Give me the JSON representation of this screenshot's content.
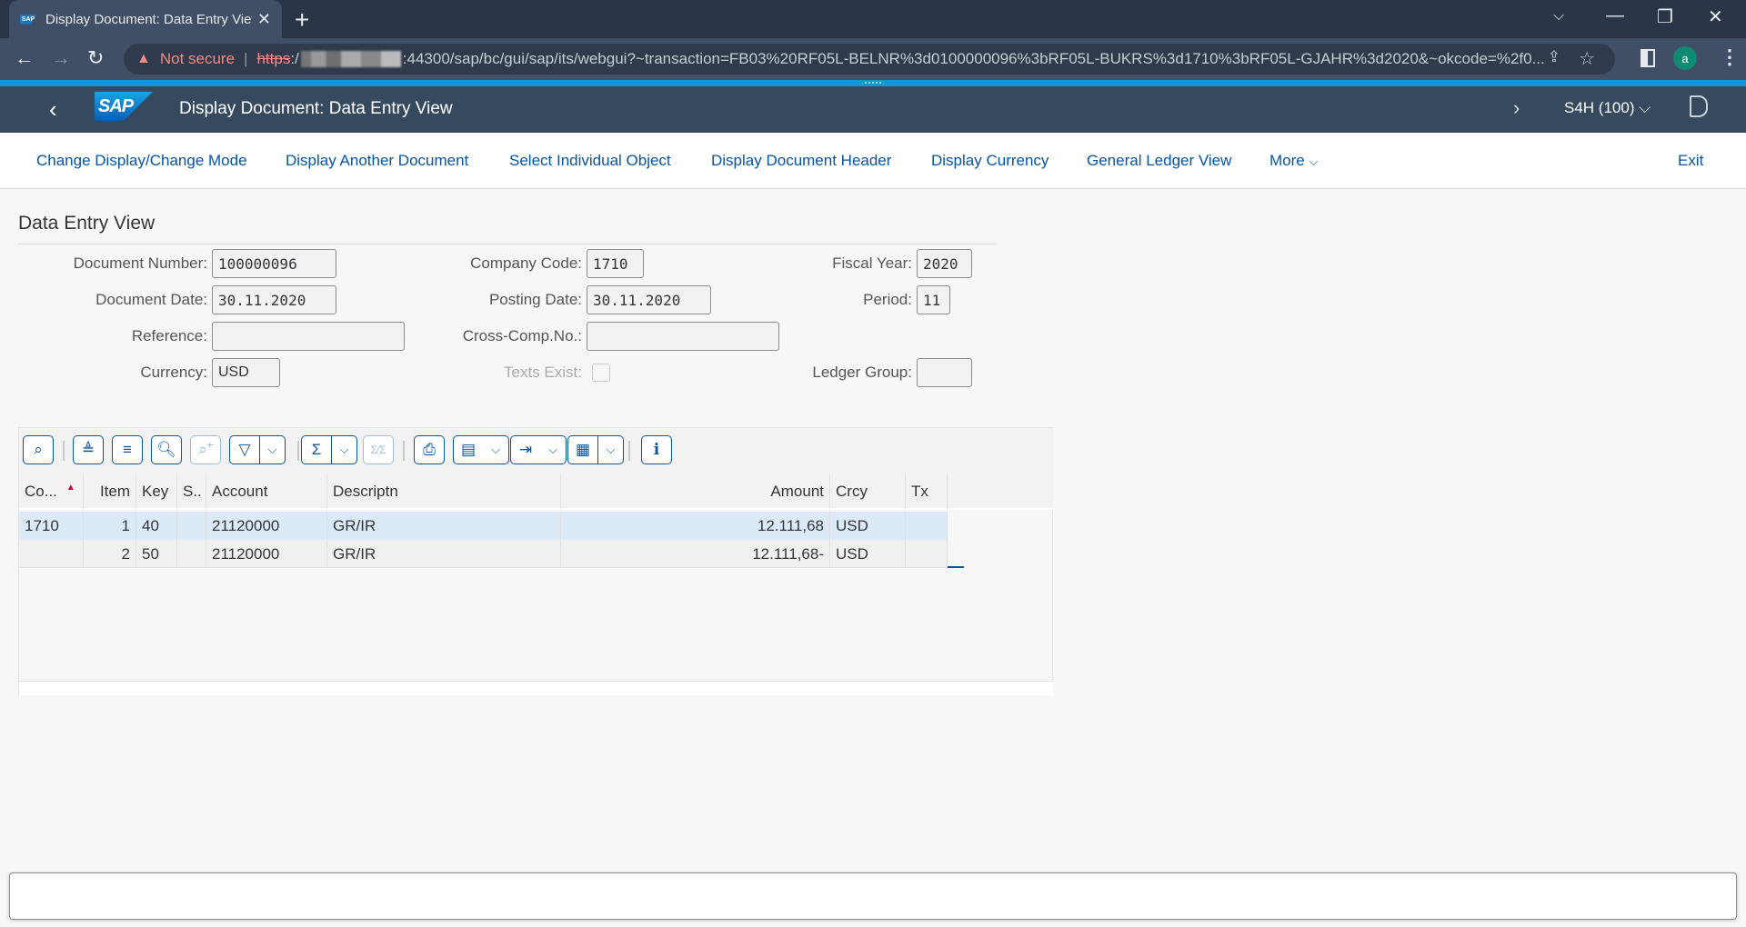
{
  "browser": {
    "tab_title": "Display Document: Data Entry View",
    "favicon_label": "SAP",
    "security_label": "Not secure",
    "url_scheme": "https",
    "url_rest": ":44300/sap/bc/gui/sap/its/webgui?~transaction=FB03%20RF05L-BELNR%3d0100000096%3bRF05L-BUKRS%3d1710%3bRF05L-GJAHR%3d2020&~okcode=%2f0...",
    "profile_initial": "a"
  },
  "shell": {
    "logo": "SAP",
    "title": "Display Document: Data Entry View",
    "system": "S4H (100)"
  },
  "toolbar": {
    "items": [
      "Change Display/Change Mode",
      "Display Another Document",
      "Select Individual Object",
      "Display Document Header",
      "Display Currency",
      "General Ledger View",
      "More"
    ],
    "exit": "Exit"
  },
  "header": {
    "section_title": "Data Entry View",
    "fields": {
      "document_number": {
        "label": "Document Number:",
        "value": "100000096"
      },
      "document_date": {
        "label": "Document Date:",
        "value": "30.11.2020"
      },
      "reference": {
        "label": "Reference:",
        "value": ""
      },
      "currency": {
        "label": "Currency:",
        "value": "USD"
      },
      "company_code": {
        "label": "Company Code:",
        "value": "1710"
      },
      "posting_date": {
        "label": "Posting Date:",
        "value": "30.11.2020"
      },
      "cross_comp_no": {
        "label": "Cross-Comp.No.:",
        "value": ""
      },
      "texts_exist": {
        "label": "Texts Exist:",
        "checked": false
      },
      "fiscal_year": {
        "label": "Fiscal Year:",
        "value": "2020"
      },
      "period": {
        "label": "Period:",
        "value": "11"
      },
      "ledger_group": {
        "label": "Ledger Group:",
        "value": ""
      }
    }
  },
  "alv": {
    "toolbar_icons": [
      "details-icon",
      "sort-ascending-icon",
      "sort-descending-icon",
      "find-icon",
      "find-next-icon",
      "filter-icon",
      "sum-icon",
      "subtotal-icon",
      "print-icon",
      "view-icon",
      "export-icon",
      "layout-settings-icon",
      "info-icon"
    ],
    "columns": [
      "Co...",
      "Item",
      "Key",
      "S..",
      "Account",
      "Descriptn",
      "Amount",
      "Crcy",
      "Tx"
    ],
    "rows": [
      {
        "co": "1710",
        "item": "1",
        "key": "40",
        "s": "",
        "account": "21120000",
        "descr": "GR/IR",
        "amount": "12.111,68",
        "crcy": "USD",
        "tx": "",
        "selected": true
      },
      {
        "co": "",
        "item": "2",
        "key": "50",
        "s": "",
        "account": "21120000",
        "descr": "GR/IR",
        "amount": "12.111,68-",
        "crcy": "USD",
        "tx": "",
        "selected": false
      }
    ]
  },
  "colors": {
    "shell_bg": "#354a5f",
    "link": "#0854a0",
    "selected_row": "#dce9f6",
    "accent_stripe": "#0a9ad9"
  }
}
